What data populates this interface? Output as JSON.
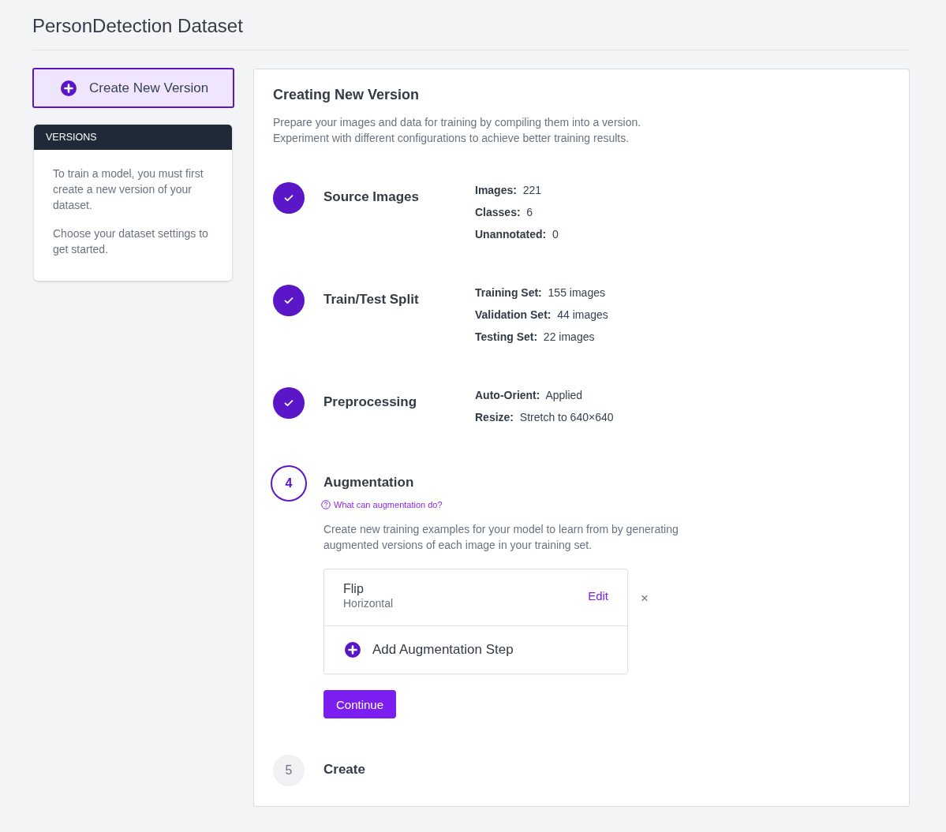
{
  "page_title": "PersonDetection Dataset",
  "create_button": {
    "label": "Create New Version"
  },
  "versions_panel": {
    "header": "VERSIONS",
    "paragraphs": [
      "To train a model, you must first create a new version of your dataset.",
      "Choose your dataset settings to get started."
    ]
  },
  "main": {
    "title": "Creating New Version",
    "description": [
      "Prepare your images and data for training by compiling them into a version.",
      "Experiment with different configurations to achieve better training results."
    ],
    "steps": [
      {
        "kind": "done",
        "title": "Source Images",
        "details": [
          "**Images:**  221",
          "**Classes:**  6",
          "**Unannotated:**  0"
        ]
      },
      {
        "kind": "done",
        "title": "Train/Test Split",
        "details": [
          "**Training Set:**  155 images",
          "**Validation Set:**  44 images",
          "**Testing Set:**  22 images"
        ]
      },
      {
        "kind": "done",
        "title": "Preprocessing",
        "details": [
          "**Auto-Orient:**  Applied",
          "**Resize:**  Stretch to 640×640"
        ]
      },
      {
        "kind": "current",
        "marker": "4",
        "title": "Augmentation",
        "help_link": "What can augmentation do?",
        "description": "Create new training examples for your model to learn from by generating augmented versions of each image in your training set.",
        "augmentations": [
          {
            "name": "Flip",
            "value": "Horizontal",
            "edit": "Edit",
            "remove": "×"
          }
        ],
        "add_step": "Add Augmentation Step",
        "continue": "Continue"
      },
      {
        "kind": "pending",
        "marker": "5",
        "title": "Create"
      }
    ]
  }
}
